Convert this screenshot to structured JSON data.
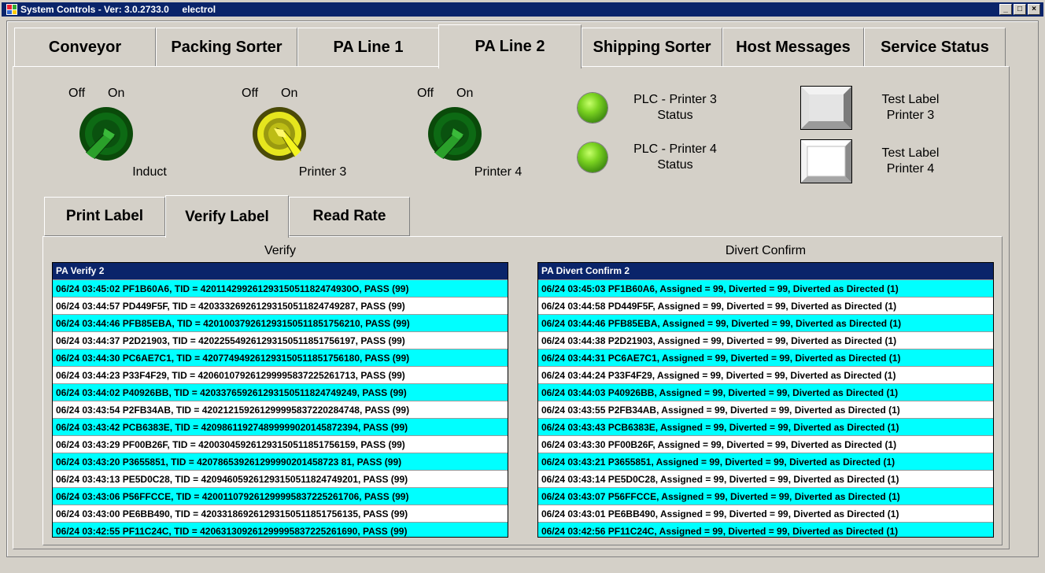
{
  "window": {
    "title": "System Controls - Ver: 3.0.2733.0     electrol",
    "minimize": "_",
    "maximize": "□",
    "close": "×"
  },
  "tabs": [
    "Conveyor",
    "Packing Sorter",
    "PA Line 1",
    "PA Line 2",
    "Shipping Sorter",
    "Host Messages",
    "Service Status"
  ],
  "active_tab": "PA Line 2",
  "toggles": [
    {
      "off": "Off",
      "on": "On",
      "label": "Induct",
      "state": "on",
      "color": "green"
    },
    {
      "off": "Off",
      "on": "On",
      "label": "Printer 3",
      "state": "on",
      "color": "yellow"
    },
    {
      "off": "Off",
      "on": "On",
      "label": "Printer 4",
      "state": "on",
      "color": "green"
    }
  ],
  "status_leds": [
    {
      "line1": "PLC - Printer 3",
      "line2": "Status",
      "color": "#7bd321"
    },
    {
      "line1": "PLC - Printer 4",
      "line2": "Status",
      "color": "#7bd321"
    }
  ],
  "test_buttons": [
    {
      "line1": "Test Label",
      "line2": "Printer 3"
    },
    {
      "line1": "Test Label",
      "line2": "Printer 4"
    }
  ],
  "subtabs": [
    "Print Label",
    "Verify Label",
    "Read Rate"
  ],
  "active_subtab": "Verify Label",
  "verify": {
    "group_title": "Verify",
    "list_header": "PA Verify 2",
    "rows": [
      "06/24  03:45:02  PF1B60A6,  TID = 42011429926129315051182474930O,  PASS (99)",
      "06/24  03:44:57  PD449F5F,  TID = 420333269261293150511824749287,  PASS (99)",
      "06/24  03:44:46  PFB85EBA,  TID = 420100379261293150511851756210,  PASS (99)",
      "06/24  03:44:37  P2D21903,  TID = 420225549261293150511851756197,  PASS (99)",
      "06/24  03:44:30  PC6AE7C1,  TID = 420774949261293150511851756180,  PASS (99)",
      "06/24  03:44:23  P33F4F29,  TID = 420601079261299995837225261713,  PASS (99)",
      "06/24  03:44:02  P40926BB,  TID = 420337659261293150511824749249,  PASS (99)",
      "06/24  03:43:54  P2FB34AB,  TID = 420212159261299995837220284748,  PASS (99)",
      "06/24  03:43:42  PCB6383E,  TID = 420986119274899999020145872394,  PASS (99)",
      "06/24  03:43:29  PF00B26F,  TID = 420030459261293150511851756159,  PASS (99)",
      "06/24  03:43:20  P3655851,  TID = 420786539261299990201458723 81,  PASS (99)",
      "06/24  03:43:13  PE5D0C28,  TID = 420946059261293150511824749201,  PASS (99)",
      "06/24  03:43:06  P56FFCCE,  TID = 420011079261299995837225261706,  PASS (99)",
      "06/24  03:43:00  PE6BB490,  TID = 420331869261293150511851756135,  PASS (99)",
      "06/24  03:42:55  PF11C24C,  TID = 420631309261299995837225261690,  PASS (99)"
    ]
  },
  "divert": {
    "group_title": "Divert Confirm",
    "list_header": "PA Divert Confirm 2",
    "rows": [
      "06/24  03:45:03  PF1B60A6,  Assigned = 99,  Diverted = 99,  Diverted as Directed (1)",
      "06/24  03:44:58  PD449F5F,  Assigned = 99,  Diverted = 99,  Diverted as Directed (1)",
      "06/24  03:44:46  PFB85EBA,  Assigned = 99,  Diverted = 99,  Diverted as Directed (1)",
      "06/24  03:44:38  P2D21903,  Assigned = 99,  Diverted = 99,  Diverted as Directed (1)",
      "06/24  03:44:31  PC6AE7C1,  Assigned = 99,  Diverted = 99,  Diverted as Directed (1)",
      "06/24  03:44:24  P33F4F29,  Assigned = 99,  Diverted = 99,  Diverted as Directed (1)",
      "06/24  03:44:03  P40926BB,  Assigned = 99,  Diverted = 99,  Diverted as Directed (1)",
      "06/24  03:43:55  P2FB34AB,  Assigned = 99,  Diverted = 99,  Diverted as Directed (1)",
      "06/24  03:43:43  PCB6383E,  Assigned = 99,  Diverted = 99,  Diverted as Directed (1)",
      "06/24  03:43:30  PF00B26F,  Assigned = 99,  Diverted = 99,  Diverted as Directed (1)",
      "06/24  03:43:21  P3655851,  Assigned = 99,  Diverted = 99,  Diverted as Directed (1)",
      "06/24  03:43:14  PE5D0C28,  Assigned = 99,  Diverted = 99,  Diverted as Directed (1)",
      "06/24  03:43:07  P56FFCCE,  Assigned = 99,  Diverted = 99,  Diverted as Directed (1)",
      "06/24  03:43:01  PE6BB490,  Assigned = 99,  Diverted = 99,  Diverted as Directed (1)",
      "06/24  03:42:56  PF11C24C,  Assigned = 99,  Diverted = 99,  Diverted as Directed (1)"
    ]
  },
  "colors": {
    "row_alt": "#00ffff",
    "row_plain": "#ffffff",
    "header": "#0a246a",
    "titlebar": "#0a246a"
  }
}
